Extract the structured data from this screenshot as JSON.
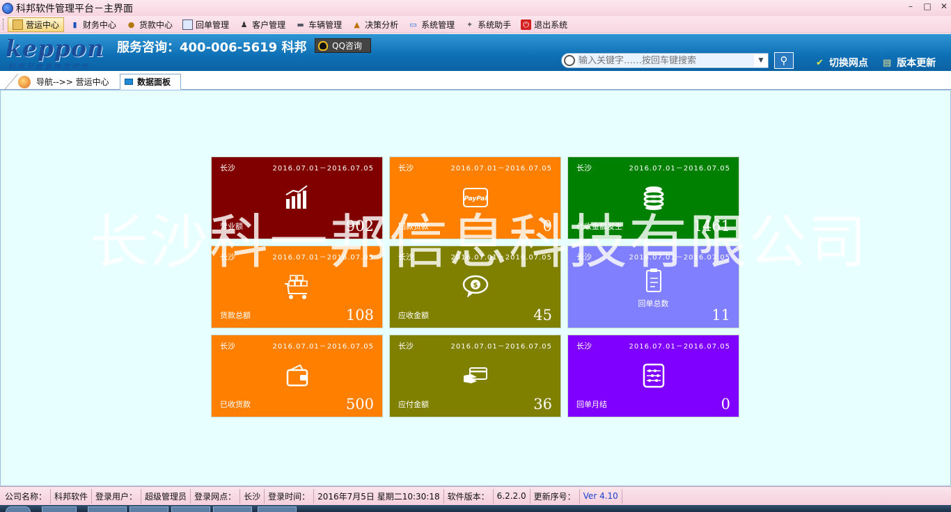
{
  "window": {
    "title": "科邦软件管理平台－主界面",
    "controls": [
      "–",
      "□",
      "✕"
    ]
  },
  "menu": [
    {
      "label": "营运中心",
      "icon": "home-icon",
      "active": true
    },
    {
      "label": "财务中心",
      "icon": "finance-chart-icon"
    },
    {
      "label": "货款中心",
      "icon": "money-bag-icon"
    },
    {
      "label": "回单管理",
      "icon": "receipt-icon"
    },
    {
      "label": "客户管理",
      "icon": "user-icon"
    },
    {
      "label": "车辆管理",
      "icon": "truck-icon"
    },
    {
      "label": "决策分析",
      "icon": "analysis-icon"
    },
    {
      "label": "系统管理",
      "icon": "system-icon"
    },
    {
      "label": "系统助手",
      "icon": "assistant-icon"
    },
    {
      "label": "退出系统",
      "icon": "exit-icon"
    }
  ],
  "header": {
    "logo": "keppon",
    "slogan": "科邦开启县物流时代",
    "hotline": "服务咨询：400-006-5619 科邦",
    "qq_button": "QQ咨询",
    "search_placeholder": "输入关键字……按回车键搜索",
    "switch_branch": "切换网点",
    "update_version": "版本更新"
  },
  "tabs": [
    {
      "label": "导航-->> 营运中心"
    },
    {
      "label": "数据面板"
    }
  ],
  "tiles": [
    {
      "city": "长沙",
      "range": "2016.07.01－2016.07.05",
      "label": "营业额",
      "value": "902",
      "icon": "bar-chart-icon",
      "color": "#800000"
    },
    {
      "city": "长沙",
      "range": "2016.07.01－2016.07.05",
      "label": "回款货款",
      "value": "0",
      "icon": "paypal-icon",
      "color": "#ff8000"
    },
    {
      "city": "长沙",
      "range": "2016.07.01－2016.07.05",
      "label": "代收金额发生",
      "value": "1461",
      "icon": "coin-stack-icon",
      "color": "#008000"
    },
    {
      "city": "长沙",
      "range": "2016.07.01－2016.07.05",
      "label": "货款总额",
      "value": "108",
      "icon": "cart-icon",
      "color": "#ff8000"
    },
    {
      "city": "长沙",
      "range": "2016.07.01－2016.07.05",
      "label": "应收金额",
      "value": "45",
      "icon": "dollar-bubble-icon",
      "color": "#808000"
    },
    {
      "city": "长沙",
      "range": "2016.07.01－2016.07.05",
      "label": "回单总数",
      "value": "11",
      "icon": "clipboard-icon",
      "color": "#8080ff"
    },
    {
      "city": "长沙",
      "range": "2016.07.01－2016.07.05",
      "label": "已收货款",
      "value": "500",
      "icon": "wallet-icon",
      "color": "#ff8000"
    },
    {
      "city": "长沙",
      "range": "2016.07.01－2016.07.05",
      "label": "应付金额",
      "value": "36",
      "icon": "card-hand-icon",
      "color": "#808000"
    },
    {
      "city": "长沙",
      "range": "2016.07.01－2016.07.05",
      "label": "回单月结",
      "value": "0",
      "icon": "abacus-icon",
      "color": "#8000ff"
    }
  ],
  "watermark": "长沙科一邦信息科技有限公司",
  "status": {
    "company_label": "公司名称：",
    "company": "科邦软件",
    "user_label": "登录用户：",
    "user": "超级管理员",
    "branch_label": "登录网点：",
    "branch": "长沙",
    "time_label": "登录时间：",
    "time": "2016年7月5日 星期二10:30:18",
    "sw_version_label": "软件版本：",
    "sw_version": "6.2.2.0",
    "update_seq_label": "更新序号：",
    "update_seq": "Ver 4.10"
  }
}
